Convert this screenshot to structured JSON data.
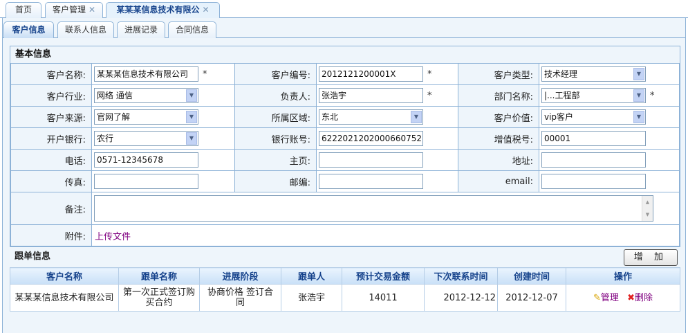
{
  "tabs": [
    {
      "label": "首页"
    },
    {
      "label": "客户管理",
      "close": "✕"
    },
    {
      "label": "某某某信息技术有限公",
      "close": "✕"
    }
  ],
  "subtabs": [
    "客户信息",
    "联系人信息",
    "进展记录",
    "合同信息"
  ],
  "basic": {
    "title": "基本信息",
    "labels": {
      "name": "客户名称:",
      "code": "客户编号:",
      "type": "客户类型:",
      "industry": "客户行业:",
      "owner": "负责人:",
      "dept": "部门名称:",
      "source": "客户来源:",
      "region": "所属区域:",
      "value": "客户价值:",
      "bank": "开户银行:",
      "account": "银行账号:",
      "tax": "增值税号:",
      "phone": "电话:",
      "homepage": "主页:",
      "address": "地址:",
      "fax": "传真:",
      "zip": "邮编:",
      "email": "email:",
      "remark": "备注:",
      "attach": "附件:"
    },
    "values": {
      "name": "某某某信息技术有限公司",
      "code": "2012121200001X",
      "type": "技术经理",
      "industry": "网络 通信",
      "owner": "张浩宇",
      "dept": "|...工程部",
      "source": "官网了解",
      "region": "东北",
      "value": "vip客户",
      "bank": "农行",
      "account": "6222021202000660752",
      "tax": "00001",
      "phone": "0571-12345678",
      "homepage": "",
      "address": "",
      "fax": "",
      "zip": "",
      "email": "",
      "remark": ""
    },
    "required_mark": "*",
    "upload_link": "上传文件"
  },
  "follow": {
    "title": "跟单信息",
    "add_label": "增 加",
    "columns": [
      "客户名称",
      "跟单名称",
      "进展阶段",
      "跟单人",
      "预计交易金额",
      "下次联系时间",
      "创建时间",
      "操作"
    ],
    "rows": [
      {
        "customer": "某某某信息技术有限公司",
        "name": "第一次正式签订购买合约",
        "stage": "协商价格 签订合同",
        "person": "张浩宇",
        "amount": "14011",
        "next": "2012-12-12",
        "created": "2012-12-07",
        "manage": "管理",
        "delete": "删除"
      }
    ]
  }
}
